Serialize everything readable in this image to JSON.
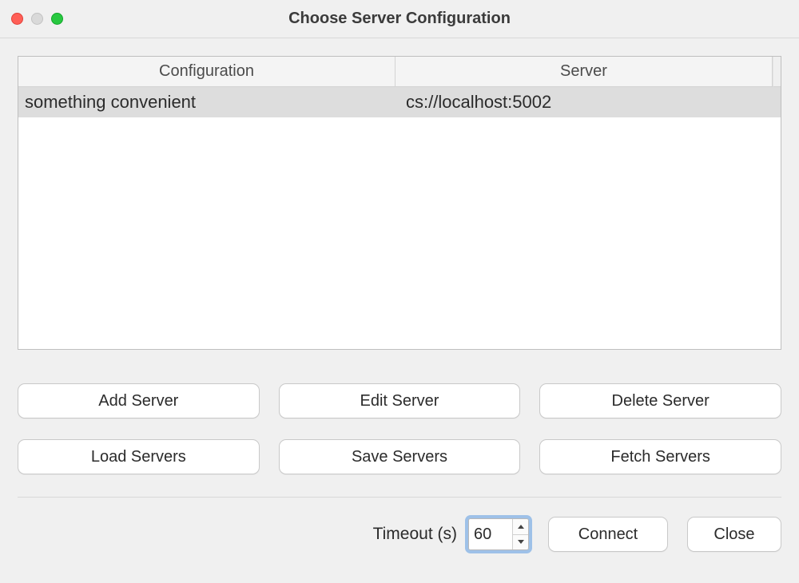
{
  "window": {
    "title": "Choose Server Configuration"
  },
  "table": {
    "headers": {
      "config": "Configuration",
      "server": "Server"
    },
    "rows": [
      {
        "config": "something convenient",
        "server": "cs://localhost:5002",
        "selected": true
      }
    ]
  },
  "buttons": {
    "add": "Add Server",
    "edit": "Edit Server",
    "delete": "Delete Server",
    "load": "Load Servers",
    "save": "Save Servers",
    "fetch": "Fetch Servers"
  },
  "footer": {
    "timeout_label": "Timeout (s)",
    "timeout_value": "60",
    "connect": "Connect",
    "close": "Close"
  }
}
